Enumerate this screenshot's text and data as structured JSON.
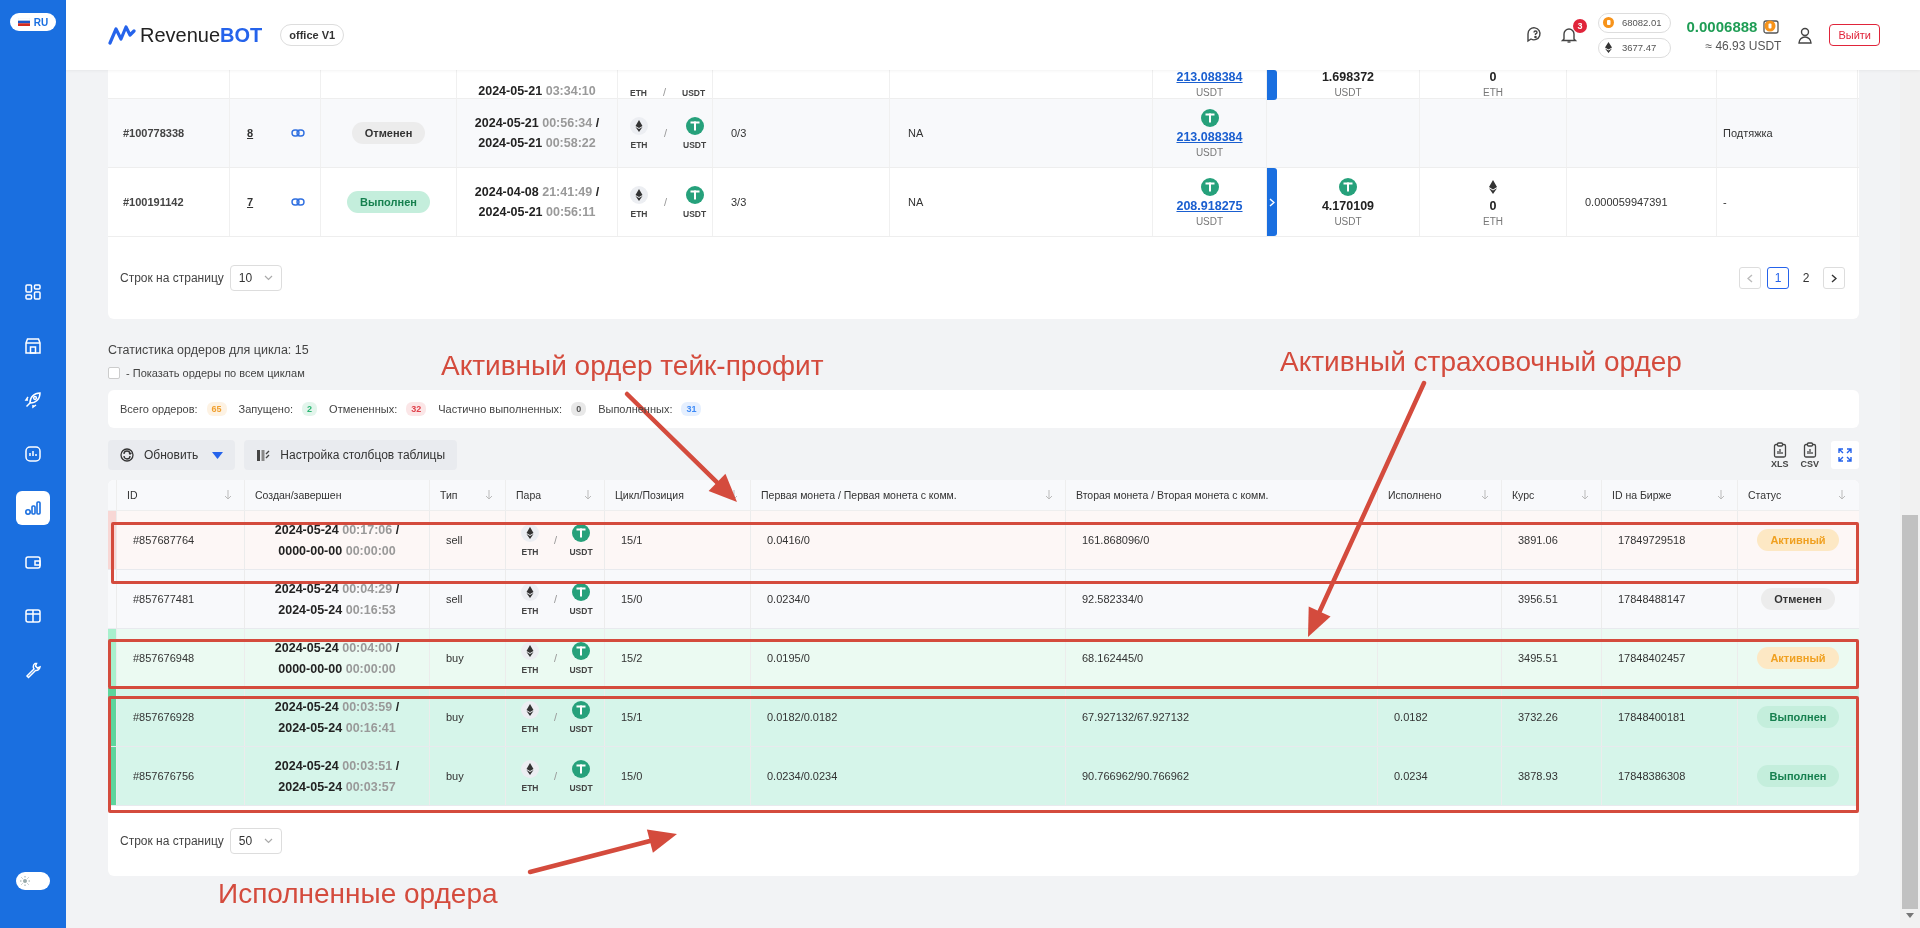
{
  "sidebar": {
    "language": "RU",
    "dark_mode": false,
    "items": [
      {
        "kind": "dashboard",
        "selected": false
      },
      {
        "kind": "store",
        "selected": false
      },
      {
        "kind": "rocket",
        "selected": false
      },
      {
        "kind": "monitor",
        "selected": false
      },
      {
        "kind": "stats",
        "selected": true
      },
      {
        "kind": "wallet",
        "selected": false
      },
      {
        "kind": "gift",
        "selected": false
      },
      {
        "kind": "tools",
        "selected": false
      }
    ]
  },
  "header": {
    "logo": {
      "name": "Revenue",
      "accent": "BOT"
    },
    "workspace": "office V1",
    "notifications": "3",
    "prices": [
      {
        "kind": "btc",
        "value": "68082.01"
      },
      {
        "kind": "eth",
        "value": "3677.47"
      }
    ],
    "balance": "0.0006888",
    "balance_usd": "≈ 46.93 USDT",
    "logout": "Выйти"
  },
  "cycles_table": {
    "rows": [
      {
        "partial": true,
        "finished": {
          "date": "2024-05-21",
          "time": "03:34:10"
        },
        "pair": [
          {
            "label": "ETH"
          },
          {
            "label": "USDT"
          }
        ],
        "pair_separator": "/",
        "invested": {
          "value": "213.088384",
          "unit": "USDT"
        },
        "expandable": true,
        "received": {
          "value": "1.698372",
          "unit": "USDT"
        },
        "balance": {
          "value": "0",
          "unit": "ETH"
        }
      },
      {
        "partial": false,
        "id": "#100778338",
        "cycle": "8",
        "status": {
          "label": "Отменен",
          "kind": "canceled"
        },
        "created": {
          "date": "2024-05-21",
          "time": "00:56:34"
        },
        "date_separator": "/",
        "finished": {
          "date": "2024-05-21",
          "time": "00:58:22"
        },
        "pair": [
          {
            "label": "ETH",
            "kind": "eth"
          },
          {
            "label": "USDT",
            "kind": "usdt"
          }
        ],
        "pair_separator": "/",
        "positions": "0/3",
        "note": "NA",
        "invested": {
          "value": "213.088384",
          "unit": "USDT",
          "kind": "usdt"
        },
        "expandable": false,
        "comment": "Подтяжка"
      },
      {
        "partial": false,
        "id": "#100191142",
        "cycle": "7",
        "status": {
          "label": "Выполнен",
          "kind": "done"
        },
        "created": {
          "date": "2024-04-08",
          "time": "21:41:49"
        },
        "date_separator": "/",
        "finished": {
          "date": "2024-05-21",
          "time": "00:56:11"
        },
        "pair": [
          {
            "label": "ETH",
            "kind": "eth"
          },
          {
            "label": "USDT",
            "kind": "usdt"
          }
        ],
        "pair_separator": "/",
        "positions": "3/3",
        "note": "NA",
        "invested": {
          "value": "208.918275",
          "unit": "USDT",
          "kind": "usdt"
        },
        "expandable": true,
        "received": {
          "value": "4.170109",
          "unit": "USDT",
          "kind": "usdt"
        },
        "balance": {
          "value": "0",
          "unit": "ETH",
          "kind": "eth"
        },
        "fee": "0.000059947391",
        "comment": "-"
      }
    ],
    "pagination": {
      "rows_label": "Строк на страницу",
      "page_size": "10",
      "pages": [
        {
          "label": "1",
          "selected": true
        },
        {
          "label": "2",
          "selected": false
        }
      ]
    }
  },
  "order_stats": {
    "title": "Статистика ордеров для цикла: 15",
    "all_cycles": {
      "label": "- Показать ордеры по всем циклам",
      "checked": false
    },
    "counters": [
      {
        "label": "Всего ордеров:",
        "value": "65",
        "color": "#f0a030"
      },
      {
        "label": "Запущено:",
        "value": "2",
        "color": "#2bb673"
      },
      {
        "label": "Отмененных:",
        "value": "32",
        "color": "#e0404a"
      },
      {
        "label": "Частично выполненных:",
        "value": "0",
        "color": "#555555"
      },
      {
        "label": "Выполненных:",
        "value": "31",
        "color": "#3d8af7"
      }
    ]
  },
  "toolbar": {
    "refresh": "Обновить",
    "columns": "Настройка столбцов таблицы",
    "exports": [
      "XLS",
      "CSV"
    ]
  },
  "orders_table": {
    "columns": [
      {
        "label": "ID",
        "sortable": true
      },
      {
        "label": "Создан/завершен",
        "sortable": false
      },
      {
        "label": "Тип",
        "sortable": true
      },
      {
        "label": "Пара",
        "sortable": true
      },
      {
        "label": "Цикл/Позиция",
        "sortable": true
      },
      {
        "label": "Первая монета / Первая монета с комм.",
        "sortable": true
      },
      {
        "label": "Вторая монета / Вторая монета с комм.",
        "sortable": false
      },
      {
        "label": "Исполнено",
        "sortable": true
      },
      {
        "label": "Курс",
        "sortable": true
      },
      {
        "label": "ID на Бирже",
        "sortable": true
      },
      {
        "label": "Статус",
        "sortable": true
      }
    ],
    "rows": [
      {
        "kind": "takeprofit",
        "id": "#857687764",
        "created": {
          "date": "2024-05-24",
          "time": "00:17:06"
        },
        "date_separator": "/",
        "finished": {
          "date": "0000-00-00",
          "time": "00:00:00"
        },
        "side": "sell",
        "pair": [
          {
            "label": "ETH",
            "kind": "eth"
          },
          {
            "label": "USDT",
            "kind": "usdt"
          }
        ],
        "pair_separator": "/",
        "position": "15/1",
        "first": "0.0416/0",
        "second": "161.868096/0",
        "rate": "3891.06",
        "exchange_id": "17849729518",
        "status": {
          "label": "Активный",
          "kind": "active"
        }
      },
      {
        "kind": "plain",
        "id": "#857677481",
        "created": {
          "date": "2024-05-24",
          "time": "00:04:29"
        },
        "date_separator": "/",
        "finished": {
          "date": "2024-05-24",
          "time": "00:16:53"
        },
        "side": "sell",
        "pair": [
          {
            "label": "ETH",
            "kind": "eth"
          },
          {
            "label": "USDT",
            "kind": "usdt"
          }
        ],
        "pair_separator": "/",
        "position": "15/0",
        "first": "0.0234/0",
        "second": "92.582334/0",
        "rate": "3956.51",
        "exchange_id": "17848488147",
        "status": {
          "label": "Отменен",
          "kind": "canceled"
        }
      },
      {
        "kind": "insurance",
        "id": "#857676948",
        "created": {
          "date": "2024-05-24",
          "time": "00:04:00"
        },
        "date_separator": "/",
        "finished": {
          "date": "0000-00-00",
          "time": "00:00:00"
        },
        "side": "buy",
        "pair": [
          {
            "label": "ETH",
            "kind": "eth"
          },
          {
            "label": "USDT",
            "kind": "usdt"
          }
        ],
        "pair_separator": "/",
        "position": "15/2",
        "first": "0.0195/0",
        "second": "68.162445/0",
        "rate": "3495.51",
        "exchange_id": "17848402457",
        "status": {
          "label": "Активный",
          "kind": "active"
        }
      },
      {
        "kind": "filled",
        "id": "#857676928",
        "created": {
          "date": "2024-05-24",
          "time": "00:03:59"
        },
        "date_separator": "/",
        "finished": {
          "date": "2024-05-24",
          "time": "00:16:41"
        },
        "side": "buy",
        "pair": [
          {
            "label": "ETH",
            "kind": "eth"
          },
          {
            "label": "USDT",
            "kind": "usdt"
          }
        ],
        "pair_separator": "/",
        "position": "15/1",
        "first": "0.0182/0.0182",
        "second": "67.927132/67.927132",
        "filled": "0.0182",
        "rate": "3732.26",
        "exchange_id": "17848400181",
        "status": {
          "label": "Выполнен",
          "kind": "done"
        }
      },
      {
        "kind": "filled",
        "id": "#857676756",
        "created": {
          "date": "2024-05-24",
          "time": "00:03:51"
        },
        "date_separator": "/",
        "finished": {
          "date": "2024-05-24",
          "time": "00:03:57"
        },
        "side": "buy",
        "pair": [
          {
            "label": "ETH",
            "kind": "eth"
          },
          {
            "label": "USDT",
            "kind": "usdt"
          }
        ],
        "pair_separator": "/",
        "position": "15/0",
        "first": "0.0234/0.0234",
        "second": "90.766962/90.766962",
        "filled": "0.0234",
        "rate": "3878.93",
        "exchange_id": "17848386308",
        "status": {
          "label": "Выполнен",
          "kind": "done"
        }
      }
    ],
    "pagination": {
      "rows_label": "Строк на страницу",
      "page_size": "50"
    }
  },
  "annotations": [
    {
      "text": "Активный ордер тейк-профит"
    },
    {
      "text": "Активный страховочный ордер"
    },
    {
      "text": "Исполненные ордера"
    }
  ]
}
